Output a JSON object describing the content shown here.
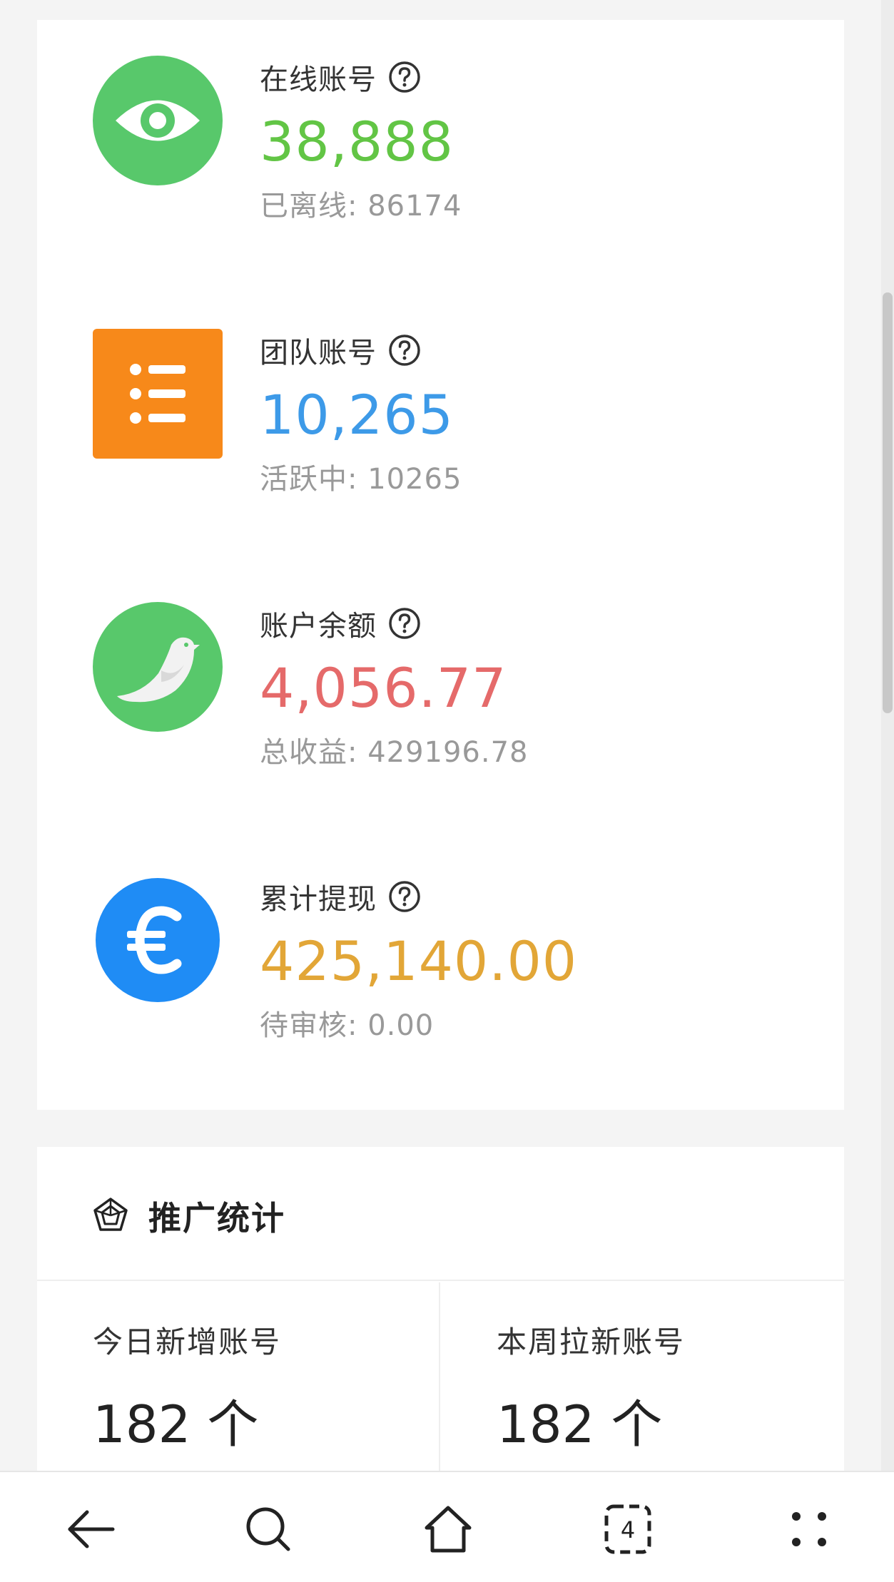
{
  "stats": [
    {
      "label": "在线账号",
      "value": "38,888",
      "sub": "已离线: 86174",
      "icon": "eye-icon",
      "icon_color": "#58c86b",
      "value_color": "#62c545"
    },
    {
      "label": "团队账号",
      "value": "10,265",
      "sub": "活跃中: 10265",
      "icon": "list-icon",
      "icon_color": "#f7891a",
      "value_color": "#3d9ae8"
    },
    {
      "label": "账户余额",
      "value": "4,056.77",
      "sub": "总收益: 429196.78",
      "icon": "bird-icon",
      "icon_color": "#58c86b",
      "value_color": "#e56a6a"
    },
    {
      "label": "累计提现",
      "value": "425,140.00",
      "sub": "待审核: 0.00",
      "icon": "euro-icon",
      "icon_color": "#1f8cf5",
      "value_color": "#e2a637"
    }
  ],
  "promo": {
    "title": "推广统计",
    "cells": [
      {
        "label": "今日新增账号",
        "value": "182 个"
      },
      {
        "label": "本周拉新账号",
        "value": "182 个"
      }
    ]
  },
  "nav": {
    "tab_count": "4",
    "items": [
      "back-icon",
      "search-icon",
      "home-icon",
      "tabs-icon",
      "menu-dots-icon"
    ]
  }
}
